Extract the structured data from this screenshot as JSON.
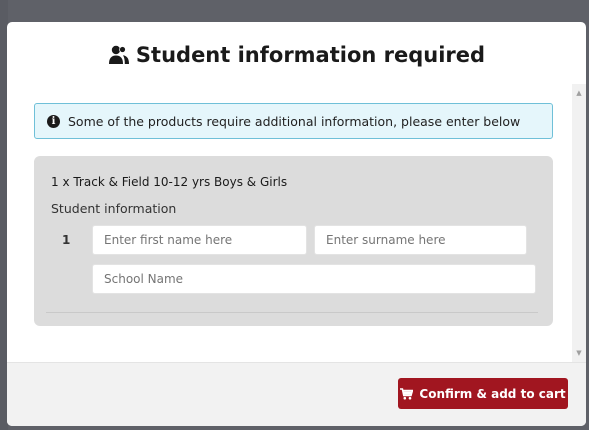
{
  "modal": {
    "title": "Student information required"
  },
  "alert": {
    "text": "Some of the products require additional information, please enter below"
  },
  "product": {
    "name": "1 x Track & Field 10-12 yrs Boys & Girls",
    "section_label": "Student information",
    "row_number": "1",
    "first_name": {
      "value": "",
      "placeholder": "Enter first name here"
    },
    "surname": {
      "value": "",
      "placeholder": "Enter surname here"
    },
    "school": {
      "value": "",
      "placeholder": "School Name"
    }
  },
  "footer": {
    "confirm_label": "Confirm & add to cart"
  },
  "icons": {
    "title_icon": "users-icon",
    "alert_icon": "info-icon",
    "button_icon": "cart-icon"
  },
  "colors": {
    "alert_bg": "#e5f6fb",
    "alert_border": "#6fc0d8",
    "panel_bg": "#dcdcdc",
    "button_bg": "#a11620"
  }
}
